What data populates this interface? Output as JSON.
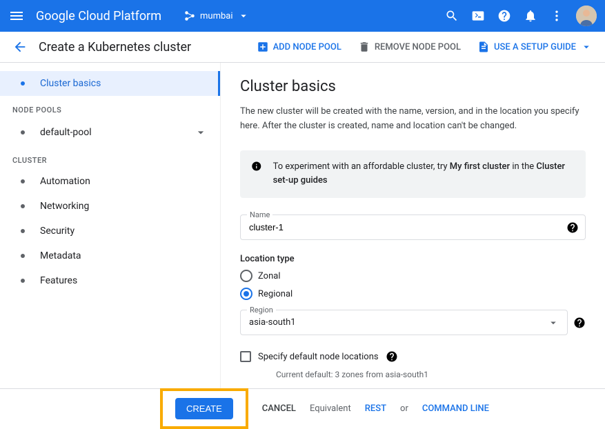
{
  "header": {
    "brand": "Google Cloud Platform",
    "project": "mumbai"
  },
  "subheader": {
    "title": "Create a Kubernetes cluster",
    "actions": {
      "add_node_pool": "ADD NODE POOL",
      "remove_node_pool": "REMOVE NODE POOL",
      "use_setup_guide": "USE A SETUP GUIDE"
    }
  },
  "sidebar": {
    "cluster_basics": "Cluster basics",
    "section_node_pools": "NODE POOLS",
    "default_pool": "default-pool",
    "section_cluster": "CLUSTER",
    "automation": "Automation",
    "networking": "Networking",
    "security": "Security",
    "metadata": "Metadata",
    "features": "Features"
  },
  "content": {
    "title": "Cluster basics",
    "description": "The new cluster will be created with the name, version, and in the location you specify here. After the cluster is created, name and location can't be changed.",
    "info_prefix": "To experiment with an affordable cluster, try ",
    "info_bold1": "My first cluster",
    "info_mid": " in the ",
    "info_bold2": "Cluster set-up guides",
    "name_label": "Name",
    "name_value": "cluster-1",
    "location_type_label": "Location type",
    "zonal": "Zonal",
    "regional": "Regional",
    "region_label": "Region",
    "region_value": "asia-south1",
    "specify_default": "Specify default node locations",
    "current_default": "Current default: 3 zones from asia-south1"
  },
  "footer": {
    "create": "CREATE",
    "cancel": "CANCEL",
    "equivalent": "Equivalent",
    "rest": "REST",
    "or": "or",
    "command_line": "COMMAND LINE"
  }
}
